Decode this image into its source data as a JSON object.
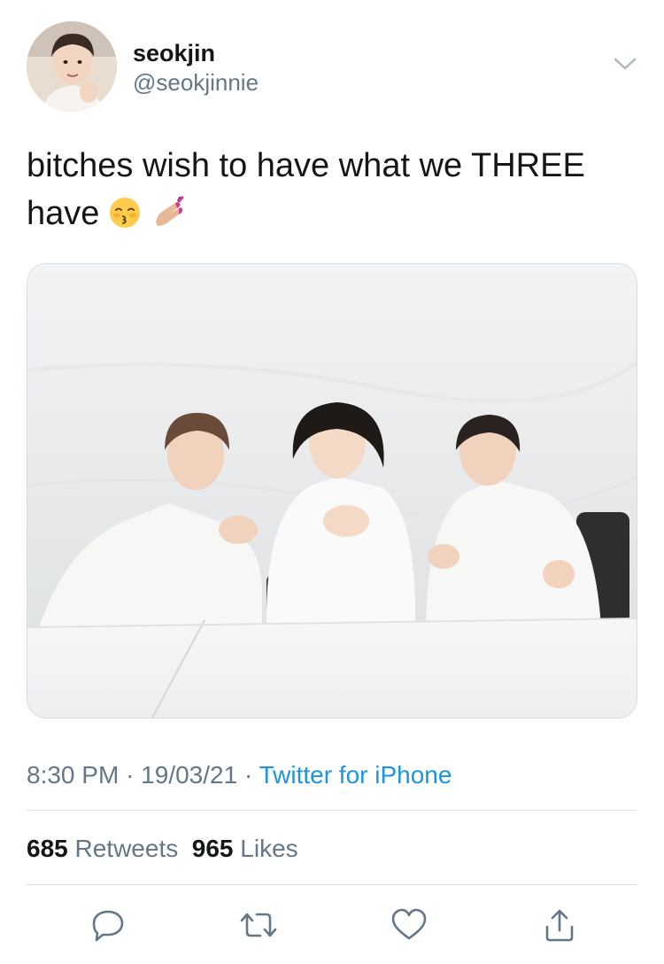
{
  "author": {
    "display_name": "seokjin",
    "handle": "@seokjinnie",
    "avatar_icon": "profile-photo"
  },
  "tweet": {
    "text": "bitches wish to have what we THREE have",
    "emojis": [
      "kissing-face-with-closed-eyes",
      "nail-polish"
    ]
  },
  "media": {
    "description_icon": "photo"
  },
  "meta": {
    "time": "8:30 PM",
    "separator": "·",
    "date": "19/03/21",
    "source": "Twitter for iPhone"
  },
  "stats": {
    "retweets_count": "685",
    "retweets_label": "Retweets",
    "likes_count": "965",
    "likes_label": "Likes"
  },
  "actions": [
    "reply-icon",
    "retweet-icon",
    "like-icon",
    "share-icon"
  ],
  "colors": {
    "text_primary": "#14171a",
    "text_secondary": "#657786",
    "link": "#1b95e0",
    "divider": "#dfe3e7"
  }
}
